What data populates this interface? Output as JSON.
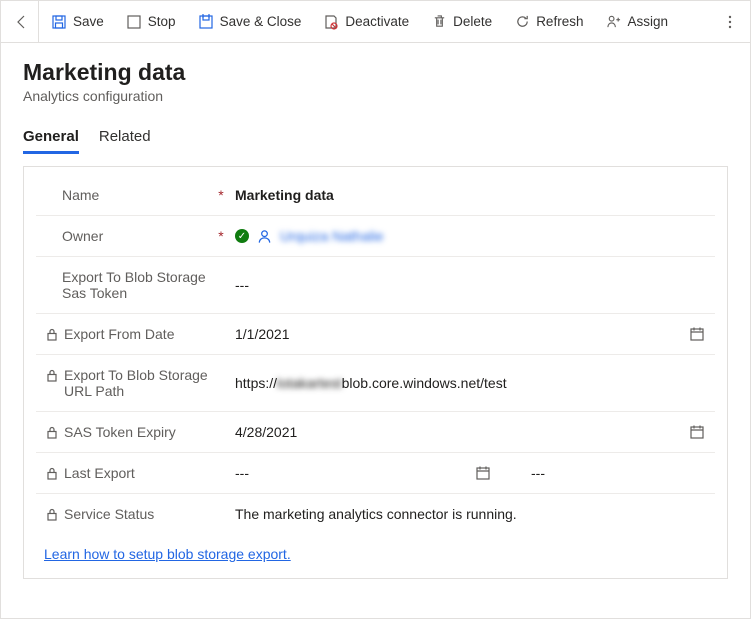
{
  "toolbar": {
    "save": "Save",
    "stop": "Stop",
    "save_close": "Save & Close",
    "deactivate": "Deactivate",
    "delete": "Delete",
    "refresh": "Refresh",
    "assign": "Assign"
  },
  "page": {
    "title": "Marketing data",
    "subtitle": "Analytics configuration"
  },
  "tabs": {
    "general": "General",
    "related": "Related"
  },
  "fields": {
    "name_label": "Name",
    "name_value": "Marketing data",
    "owner_label": "Owner",
    "owner_value": "Urquiza Nathalie",
    "sas_token_label": "Export To Blob Storage Sas Token",
    "sas_token_value": "---",
    "export_from_label": "Export From Date",
    "export_from_value": "1/1/2021",
    "url_path_label": "Export To Blob Storage URL Path",
    "url_prefix": "https://",
    "url_blur": "lotakartest",
    "url_suffix": "blob.core.windows.net/test",
    "sas_expiry_label": "SAS Token Expiry",
    "sas_expiry_value": "4/28/2021",
    "last_export_label": "Last Export",
    "last_export_date": "---",
    "last_export_time": "---",
    "service_status_label": "Service Status",
    "service_status_value": "The marketing analytics connector is running."
  },
  "help_link": "Learn how to setup blob storage export."
}
